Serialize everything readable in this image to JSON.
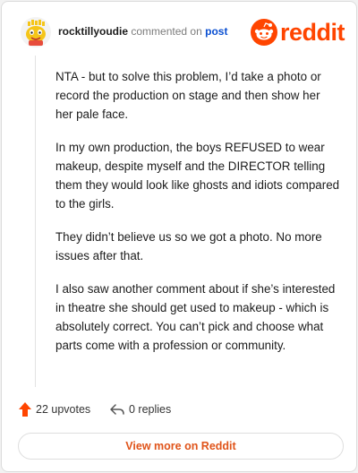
{
  "header": {
    "username": "rocktillyoudie",
    "action": "commented on",
    "post_link": "post",
    "brand": "reddit"
  },
  "comment": {
    "paragraphs": [
      "NTA - but to solve this problem, I’d take a photo or record the production on stage and then show her her pale face.",
      "In my own production, the boys REFUSED to wear makeup, despite myself and the DIRECTOR telling them they would look like ghosts and idiots compared to the girls.",
      "They didn’t believe us so we got a photo. No more issues after that.",
      "I also saw another comment about if she’s interested in theatre she should get used to makeup - which is absolutely correct. You can’t pick and choose what parts come with a profession or community."
    ]
  },
  "footer": {
    "upvotes": "22 upvotes",
    "replies": "0 replies"
  },
  "cta": {
    "label": "View more on Reddit"
  },
  "colors": {
    "brand": "#ff4500",
    "link": "#0a4fd1",
    "cta_text": "#e0541a"
  },
  "icons": {
    "upvote": "upvote-arrow-icon",
    "reply": "reply-arrow-icon",
    "avatar": "snoo-avatar",
    "logo": "reddit-snoo-logo"
  }
}
